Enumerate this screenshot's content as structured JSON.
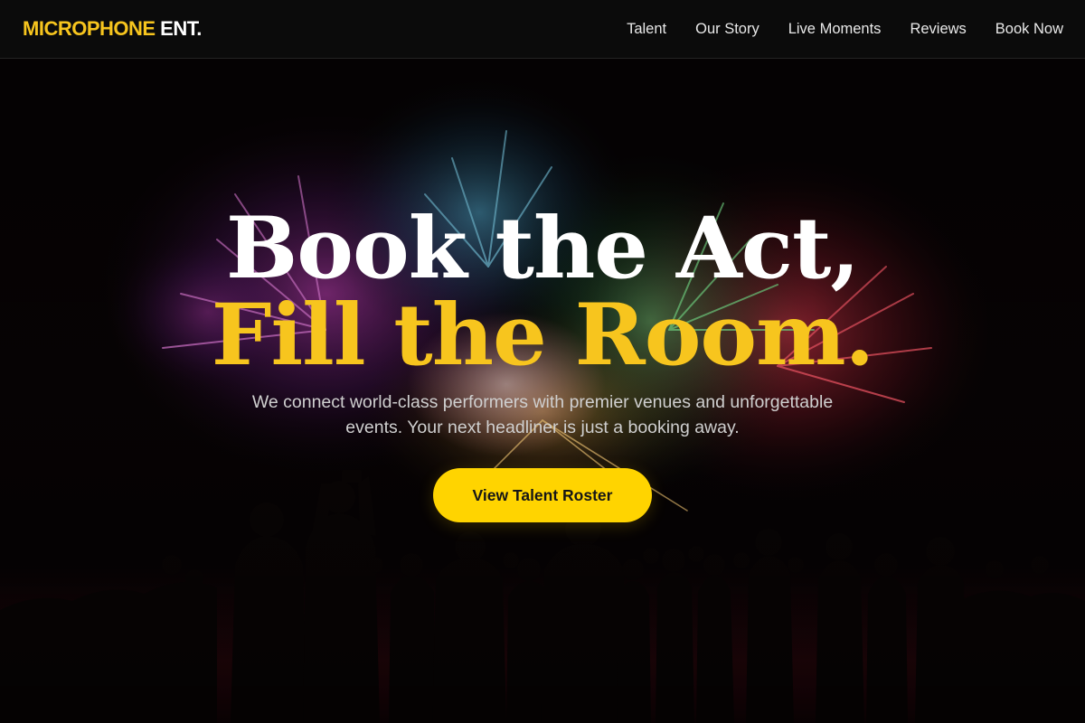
{
  "brand": {
    "accent": "MICROPHONE",
    "rest": " ENT."
  },
  "nav": {
    "links": [
      {
        "label": "Talent"
      },
      {
        "label": "Our Story"
      },
      {
        "label": "Live Moments"
      },
      {
        "label": "Reviews"
      },
      {
        "label": "Book Now"
      }
    ]
  },
  "hero": {
    "headline_line1": "Book the Act,",
    "headline_line2": "Fill the Room.",
    "subtitle": "We connect world-class performers with premier venues and unforgettable events. Your next headliner is just a booking away.",
    "cta_label": "View Talent Roster",
    "background_image": "fireworks-crowd-silhouette"
  },
  "colors": {
    "accent": "#f7c51e",
    "cta": "#ffd400",
    "nav_bg": "#0b0b0b",
    "hero_bg": "#060303"
  }
}
